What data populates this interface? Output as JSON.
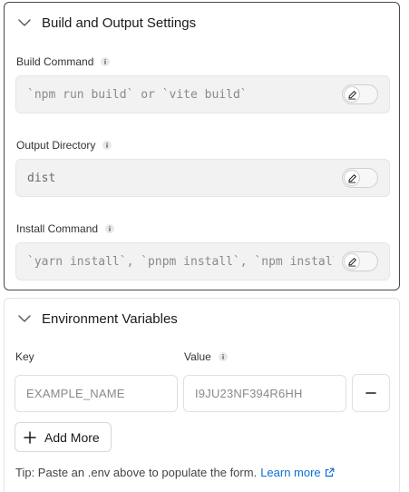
{
  "build_section": {
    "title": "Build and Output Settings",
    "fields": [
      {
        "label": "Build Command",
        "placeholder": "`npm run build` or `vite build`",
        "value": ""
      },
      {
        "label": "Output Directory",
        "placeholder": "",
        "value": "dist"
      },
      {
        "label": "Install Command",
        "placeholder": "`yarn install`, `pnpm install`, `npm install`, or `bun install`",
        "value": ""
      }
    ]
  },
  "env_section": {
    "title": "Environment Variables",
    "key_label": "Key",
    "value_label": "Value",
    "key_placeholder": "EXAMPLE_NAME",
    "value_placeholder": "I9JU23NF394R6HH",
    "add_button_label": "Add More",
    "tip_text": "Tip: Paste an .env above to populate the form.",
    "learn_more_label": "Learn more"
  },
  "icons": {
    "chevron": "chevron-down-icon",
    "info": "info-icon",
    "pencil": "pencil-icon",
    "minus": "minus-icon",
    "plus": "plus-icon",
    "external": "external-link-icon"
  },
  "colors": {
    "link": "#0a6fd6",
    "input_bg": "#f2f2f2",
    "border": "#e0e0e0"
  }
}
